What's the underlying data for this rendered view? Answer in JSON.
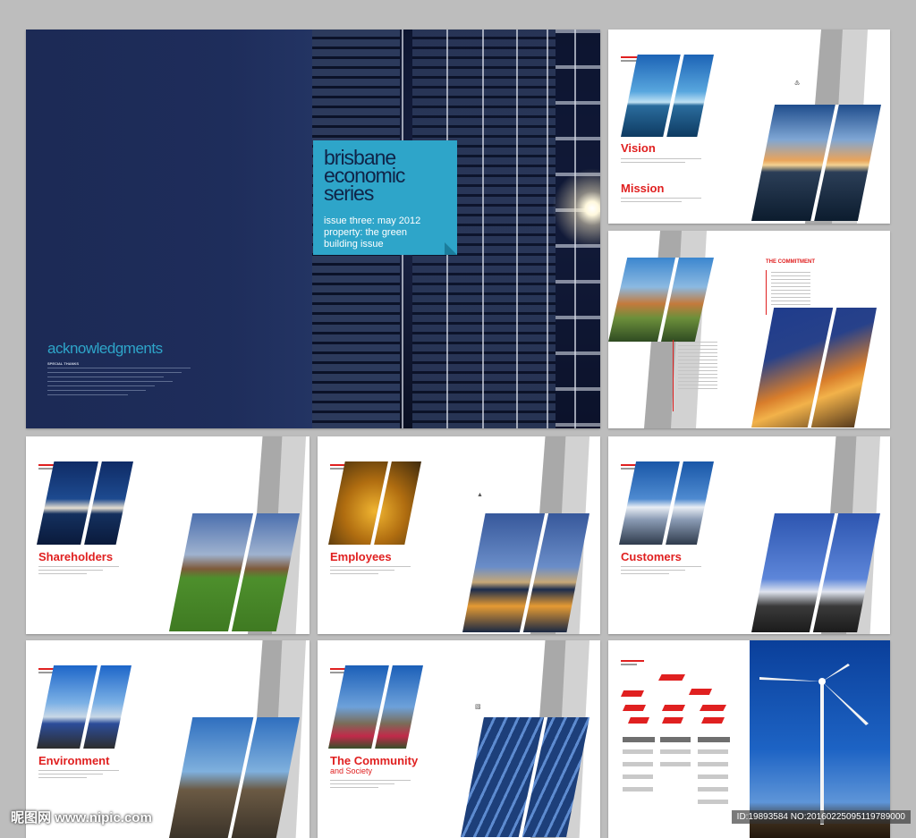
{
  "cover": {
    "title": "brisbane\neconomic\nseries",
    "subtitle": "issue three: may 2012\nproperty: the green\nbuilding issue",
    "back_heading": "acknowledgments",
    "back_label": "SPECIAL THANKS"
  },
  "vision_page": {
    "vision": "Vision",
    "mission": "Mission"
  },
  "shareholders_page": {
    "heading": "Shareholders"
  },
  "employees_page": {
    "heading": "Employees"
  },
  "customers_page": {
    "heading": "Customers"
  },
  "environment_page": {
    "heading": "Environment"
  },
  "community_page": {
    "heading": "The Community",
    "subheading": "and Society"
  },
  "contents_page": {
    "heading": "THE COMMITMENT"
  },
  "watermark": {
    "site": "昵图网 www.nipic.com",
    "id": "ID:19893584 NO:20160225095119789000"
  },
  "colors": {
    "accent": "#e02020",
    "cover_navy": "#1e2d5b",
    "title_box": "#2ea5c9"
  }
}
